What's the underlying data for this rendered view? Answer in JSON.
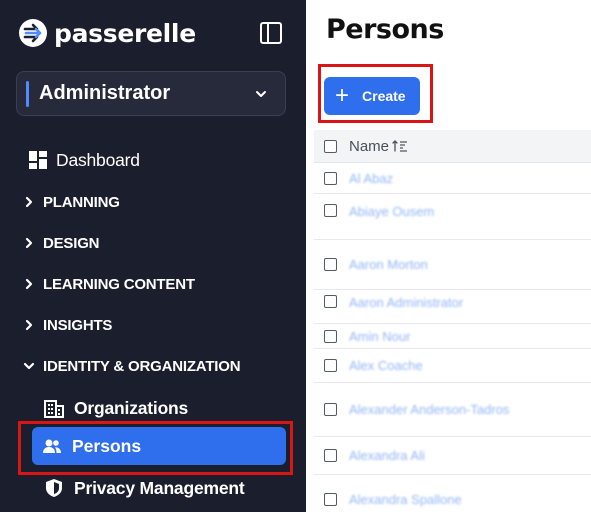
{
  "app": {
    "name": "passerelle"
  },
  "sidebar": {
    "role": "Administrator",
    "nav": {
      "dashboard": "Dashboard",
      "planning": "PLANNING",
      "design": "DESIGN",
      "learning_content": "LEARNING CONTENT",
      "insights": "INSIGHTS",
      "identity": "IDENTITY & ORGANIZATION",
      "organizations": "Organizations",
      "persons": "Persons",
      "privacy": "Privacy Management"
    }
  },
  "main": {
    "title": "Persons",
    "create_label": "Create",
    "table": {
      "name_header": "Name",
      "rows": [
        "Al Abaz",
        "Abiaye Ousem",
        "Aaron Morton",
        "Aaron Administrator",
        "Amin Nour",
        "Alex Coache",
        "Alexander Anderson-Tadros",
        "Alexandra Ali",
        "Alexandra Spallone"
      ]
    }
  },
  "colors": {
    "sidebar_bg": "#1b1e2d",
    "accent": "#2f6fed",
    "highlight": "#d91515"
  }
}
